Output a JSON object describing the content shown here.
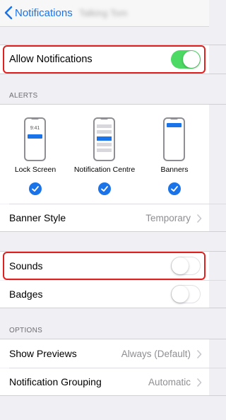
{
  "nav": {
    "back_label": "Notifications",
    "app_name": "Talking Tom"
  },
  "allow": {
    "label": "Allow Notifications",
    "enabled": true
  },
  "alerts": {
    "header": "ALERTS",
    "styles": [
      {
        "label": "Lock Screen",
        "preview_time": "9:41",
        "checked": true
      },
      {
        "label": "Notification Centre",
        "checked": true
      },
      {
        "label": "Banners",
        "checked": true
      }
    ],
    "banner_style": {
      "label": "Banner Style",
      "value": "Temporary"
    }
  },
  "sounds": {
    "label": "Sounds",
    "enabled": false
  },
  "badges": {
    "label": "Badges",
    "enabled": false
  },
  "options": {
    "header": "OPTIONS",
    "show_previews": {
      "label": "Show Previews",
      "value": "Always (Default)"
    },
    "grouping": {
      "label": "Notification Grouping",
      "value": "Automatic"
    }
  },
  "colors": {
    "accent": "#1a73e8",
    "toggle_on": "#4cd964",
    "highlight": "#e0201f",
    "background": "#efeff4"
  }
}
